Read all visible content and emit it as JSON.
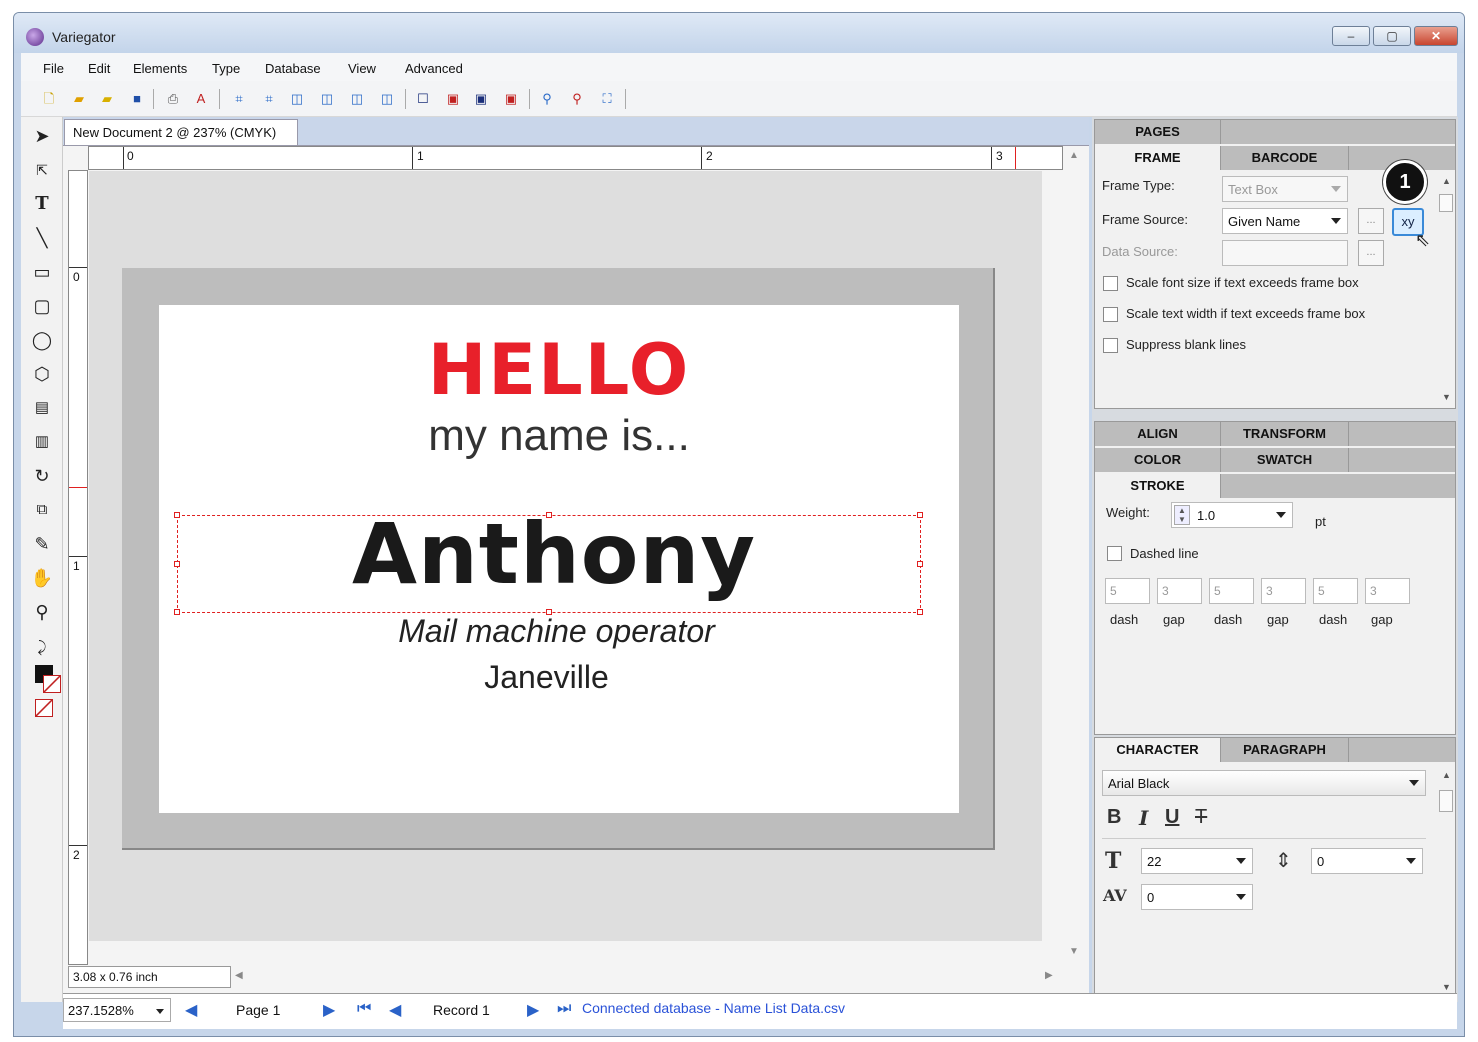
{
  "window": {
    "title": "Variegator",
    "min": "–",
    "max": "▢",
    "close": "✕"
  },
  "menu": [
    "File",
    "Edit",
    "Elements",
    "Type",
    "Database",
    "View",
    "Advanced"
  ],
  "document": {
    "tab_title": "New Document 2 @ 237% (CMYK)",
    "ruler_h": [
      "0",
      "1",
      "2",
      "3"
    ],
    "ruler_v": [
      "0",
      "1",
      "2"
    ],
    "dims": "3.08 x 0.76 inch"
  },
  "badge": {
    "hello": "HELLO",
    "subtitle": "my name is...",
    "name": "Anthony",
    "job": "Mail machine operator",
    "city": "Janeville"
  },
  "status": {
    "zoom": "237.1528%",
    "page": "Page 1",
    "record": "Record 1",
    "connection": "Connected database - Name List Data.csv"
  },
  "panels": {
    "pages_tab": "PAGES",
    "frame_tab": "FRAME",
    "barcode_tab": "BARCODE",
    "frame_type_label": "Frame Type:",
    "frame_type_value": "Text Box",
    "frame_source_label": "Frame Source:",
    "frame_source_value": "Given Name",
    "data_source_label": "Data Source:",
    "xy_button": "xy",
    "ellipsis": "...",
    "scale_font": "Scale font size if text exceeds frame box",
    "scale_width": "Scale text width if text exceeds frame box",
    "suppress": "Suppress blank lines",
    "align_tab": "ALIGN",
    "transform_tab": "TRANSFORM",
    "color_tab": "COLOR",
    "swatch_tab": "SWATCH",
    "stroke_tab": "STROKE",
    "weight_label": "Weight:",
    "weight_value": "1.0",
    "weight_unit": "pt",
    "dashed_line": "Dashed line",
    "dash_values": [
      "5",
      "3",
      "5",
      "3",
      "5",
      "3"
    ],
    "dash_labels": [
      "dash",
      "gap",
      "dash",
      "gap",
      "dash",
      "gap"
    ],
    "character_tab": "CHARACTER",
    "paragraph_tab": "PARAGRAPH",
    "font_name": "Arial Black",
    "bold": "B",
    "italic": "I",
    "underline": "U",
    "strike": "T",
    "font_size": "22",
    "leading": "0",
    "tracking": "0"
  },
  "callout": "1"
}
